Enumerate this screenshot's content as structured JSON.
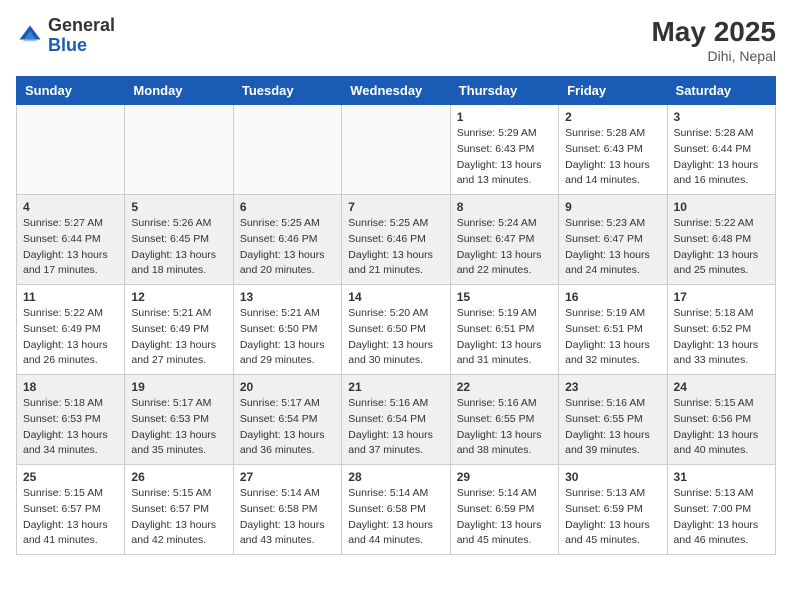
{
  "header": {
    "logo_general": "General",
    "logo_blue": "Blue",
    "month_year": "May 2025",
    "location": "Dihi, Nepal"
  },
  "weekdays": [
    "Sunday",
    "Monday",
    "Tuesday",
    "Wednesday",
    "Thursday",
    "Friday",
    "Saturday"
  ],
  "weeks": [
    [
      {
        "day": "",
        "info": ""
      },
      {
        "day": "",
        "info": ""
      },
      {
        "day": "",
        "info": ""
      },
      {
        "day": "",
        "info": ""
      },
      {
        "day": "1",
        "info": "Sunrise: 5:29 AM\nSunset: 6:43 PM\nDaylight: 13 hours\nand 13 minutes."
      },
      {
        "day": "2",
        "info": "Sunrise: 5:28 AM\nSunset: 6:43 PM\nDaylight: 13 hours\nand 14 minutes."
      },
      {
        "day": "3",
        "info": "Sunrise: 5:28 AM\nSunset: 6:44 PM\nDaylight: 13 hours\nand 16 minutes."
      }
    ],
    [
      {
        "day": "4",
        "info": "Sunrise: 5:27 AM\nSunset: 6:44 PM\nDaylight: 13 hours\nand 17 minutes."
      },
      {
        "day": "5",
        "info": "Sunrise: 5:26 AM\nSunset: 6:45 PM\nDaylight: 13 hours\nand 18 minutes."
      },
      {
        "day": "6",
        "info": "Sunrise: 5:25 AM\nSunset: 6:46 PM\nDaylight: 13 hours\nand 20 minutes."
      },
      {
        "day": "7",
        "info": "Sunrise: 5:25 AM\nSunset: 6:46 PM\nDaylight: 13 hours\nand 21 minutes."
      },
      {
        "day": "8",
        "info": "Sunrise: 5:24 AM\nSunset: 6:47 PM\nDaylight: 13 hours\nand 22 minutes."
      },
      {
        "day": "9",
        "info": "Sunrise: 5:23 AM\nSunset: 6:47 PM\nDaylight: 13 hours\nand 24 minutes."
      },
      {
        "day": "10",
        "info": "Sunrise: 5:22 AM\nSunset: 6:48 PM\nDaylight: 13 hours\nand 25 minutes."
      }
    ],
    [
      {
        "day": "11",
        "info": "Sunrise: 5:22 AM\nSunset: 6:49 PM\nDaylight: 13 hours\nand 26 minutes."
      },
      {
        "day": "12",
        "info": "Sunrise: 5:21 AM\nSunset: 6:49 PM\nDaylight: 13 hours\nand 27 minutes."
      },
      {
        "day": "13",
        "info": "Sunrise: 5:21 AM\nSunset: 6:50 PM\nDaylight: 13 hours\nand 29 minutes."
      },
      {
        "day": "14",
        "info": "Sunrise: 5:20 AM\nSunset: 6:50 PM\nDaylight: 13 hours\nand 30 minutes."
      },
      {
        "day": "15",
        "info": "Sunrise: 5:19 AM\nSunset: 6:51 PM\nDaylight: 13 hours\nand 31 minutes."
      },
      {
        "day": "16",
        "info": "Sunrise: 5:19 AM\nSunset: 6:51 PM\nDaylight: 13 hours\nand 32 minutes."
      },
      {
        "day": "17",
        "info": "Sunrise: 5:18 AM\nSunset: 6:52 PM\nDaylight: 13 hours\nand 33 minutes."
      }
    ],
    [
      {
        "day": "18",
        "info": "Sunrise: 5:18 AM\nSunset: 6:53 PM\nDaylight: 13 hours\nand 34 minutes."
      },
      {
        "day": "19",
        "info": "Sunrise: 5:17 AM\nSunset: 6:53 PM\nDaylight: 13 hours\nand 35 minutes."
      },
      {
        "day": "20",
        "info": "Sunrise: 5:17 AM\nSunset: 6:54 PM\nDaylight: 13 hours\nand 36 minutes."
      },
      {
        "day": "21",
        "info": "Sunrise: 5:16 AM\nSunset: 6:54 PM\nDaylight: 13 hours\nand 37 minutes."
      },
      {
        "day": "22",
        "info": "Sunrise: 5:16 AM\nSunset: 6:55 PM\nDaylight: 13 hours\nand 38 minutes."
      },
      {
        "day": "23",
        "info": "Sunrise: 5:16 AM\nSunset: 6:55 PM\nDaylight: 13 hours\nand 39 minutes."
      },
      {
        "day": "24",
        "info": "Sunrise: 5:15 AM\nSunset: 6:56 PM\nDaylight: 13 hours\nand 40 minutes."
      }
    ],
    [
      {
        "day": "25",
        "info": "Sunrise: 5:15 AM\nSunset: 6:57 PM\nDaylight: 13 hours\nand 41 minutes."
      },
      {
        "day": "26",
        "info": "Sunrise: 5:15 AM\nSunset: 6:57 PM\nDaylight: 13 hours\nand 42 minutes."
      },
      {
        "day": "27",
        "info": "Sunrise: 5:14 AM\nSunset: 6:58 PM\nDaylight: 13 hours\nand 43 minutes."
      },
      {
        "day": "28",
        "info": "Sunrise: 5:14 AM\nSunset: 6:58 PM\nDaylight: 13 hours\nand 44 minutes."
      },
      {
        "day": "29",
        "info": "Sunrise: 5:14 AM\nSunset: 6:59 PM\nDaylight: 13 hours\nand 45 minutes."
      },
      {
        "day": "30",
        "info": "Sunrise: 5:13 AM\nSunset: 6:59 PM\nDaylight: 13 hours\nand 45 minutes."
      },
      {
        "day": "31",
        "info": "Sunrise: 5:13 AM\nSunset: 7:00 PM\nDaylight: 13 hours\nand 46 minutes."
      }
    ]
  ]
}
